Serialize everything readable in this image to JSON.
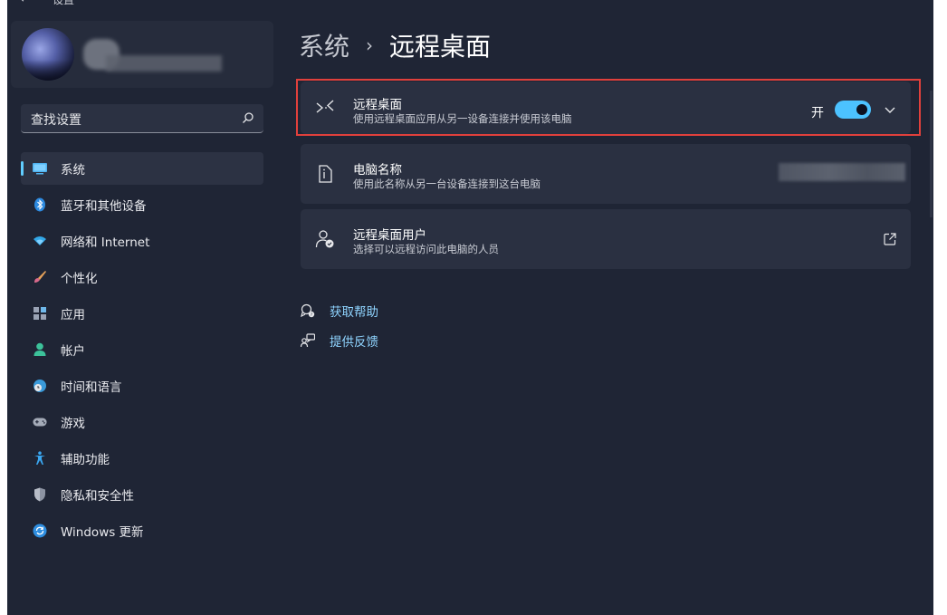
{
  "window": {
    "title": "设置"
  },
  "sidebar": {
    "search_placeholder": "查找设置",
    "items": [
      {
        "label": "系统",
        "icon": "monitor-icon",
        "active": true
      },
      {
        "label": "蓝牙和其他设备",
        "icon": "bluetooth-icon"
      },
      {
        "label": "网络和 Internet",
        "icon": "wifi-icon"
      },
      {
        "label": "个性化",
        "icon": "brush-icon"
      },
      {
        "label": "应用",
        "icon": "apps-icon"
      },
      {
        "label": "帐户",
        "icon": "account-icon"
      },
      {
        "label": "时间和语言",
        "icon": "globe-clock-icon"
      },
      {
        "label": "游戏",
        "icon": "gamepad-icon"
      },
      {
        "label": "辅助功能",
        "icon": "accessibility-icon"
      },
      {
        "label": "隐私和安全性",
        "icon": "shield-icon"
      },
      {
        "label": "Windows 更新",
        "icon": "refresh-icon"
      }
    ]
  },
  "main": {
    "breadcrumb_parent": "系统",
    "breadcrumb_sep": "›",
    "breadcrumb_current": "远程桌面",
    "cards": {
      "remote_desktop": {
        "title": "远程桌面",
        "desc": "使用远程桌面应用从另一设备连接并使用该电脑",
        "toggle_state": "开",
        "toggle_on": true
      },
      "pc_name": {
        "title": "电脑名称",
        "desc": "使用此名称从另一台设备连接到这台电脑"
      },
      "rd_users": {
        "title": "远程桌面用户",
        "desc": "选择可以远程访问此电脑的人员"
      }
    },
    "links": {
      "help": "获取帮助",
      "feedback": "提供反馈"
    }
  },
  "colors": {
    "accent": "#4cc2ff",
    "link": "#8fd4ff",
    "highlight": "#e0403c",
    "background": "#1f2535",
    "card": "#2a3041"
  }
}
